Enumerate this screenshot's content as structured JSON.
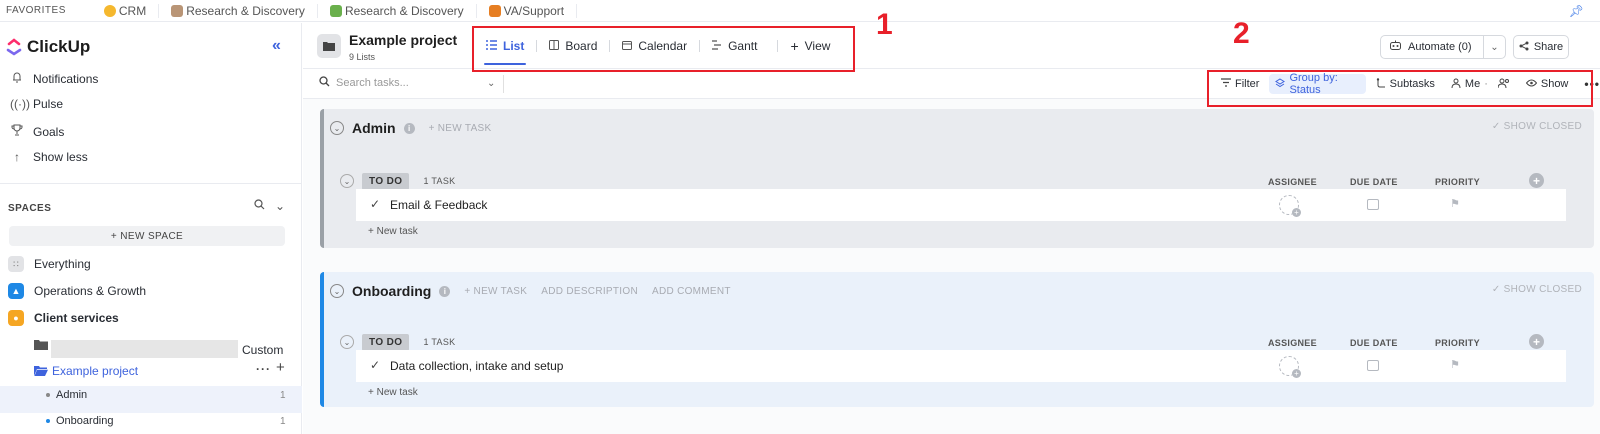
{
  "favorites": {
    "label": "FAVORITES",
    "items": [
      {
        "label": "CRM",
        "color": "#f5b82e"
      },
      {
        "label": "Research & Discovery",
        "color": "#b99576"
      },
      {
        "label": "Research & Discovery",
        "color": "#6ab04c"
      },
      {
        "label": "VA/Support",
        "color": "#e67e22"
      }
    ]
  },
  "sidebar": {
    "brand": "ClickUp",
    "nav": [
      {
        "label": "Notifications",
        "icon": "bell-icon"
      },
      {
        "label": "Pulse",
        "icon": "pulse-icon"
      },
      {
        "label": "Goals",
        "icon": "trophy-icon"
      },
      {
        "label": "Show less",
        "icon": "arrow-up-icon"
      }
    ],
    "spaces_label": "SPACES",
    "new_space": "+ NEW SPACE",
    "spaces": [
      {
        "label": "Everything",
        "color": "#e2e3e6"
      },
      {
        "label": "Operations & Growth",
        "color": "#1e88e5"
      },
      {
        "label": "Client services",
        "color": "#f5a623"
      }
    ],
    "custom_label": "Custom",
    "active_folder": "Example project",
    "lists": [
      {
        "label": "Admin",
        "count": "1"
      },
      {
        "label": "Onboarding",
        "count": "1"
      }
    ]
  },
  "header": {
    "title": "Example project",
    "subtitle": "9 Lists",
    "tabs": [
      "List",
      "Board",
      "Calendar",
      "Gantt"
    ],
    "add_view": "View",
    "automate": "Automate (0)",
    "share": "Share"
  },
  "toolbar": {
    "search_placeholder": "Search tasks...",
    "filter": "Filter",
    "group_by": "Group by: Status",
    "subtasks": "Subtasks",
    "me": "Me",
    "show": "Show",
    "more": "•••"
  },
  "groups": [
    {
      "name": "Admin",
      "links": [
        "+ NEW TASK"
      ],
      "show_closed": "✓ SHOW CLOSED",
      "status": "TO DO",
      "task_count": "1 TASK",
      "columns": [
        "ASSIGNEE",
        "DUE DATE",
        "PRIORITY"
      ],
      "task": "Email & Feedback",
      "new_task": "+ New task"
    },
    {
      "name": "Onboarding",
      "links": [
        "+ NEW TASK",
        "ADD DESCRIPTION",
        "ADD COMMENT"
      ],
      "show_closed": "✓ SHOW CLOSED",
      "status": "TO DO",
      "task_count": "1 TASK",
      "columns": [
        "ASSIGNEE",
        "DUE DATE",
        "PRIORITY"
      ],
      "task": "Data collection, intake and setup",
      "new_task": "+ New task"
    }
  ],
  "annotations": {
    "one": "1",
    "two": "2",
    "color": "#e8202a"
  }
}
